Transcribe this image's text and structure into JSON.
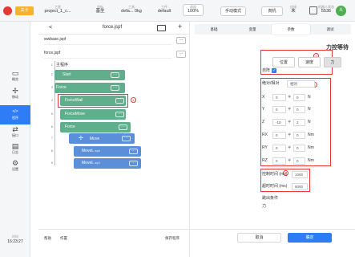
{
  "topbar": {
    "mode_label": "关卡",
    "project_small": "工程",
    "project": "project_1_c...",
    "coord_small": "坐标",
    "coord": "基坐",
    "tool_small": "工具",
    "tool": "defa... 0kg",
    "work_small": "工件",
    "work": "default",
    "speed_small": "速度",
    "speed": "100%",
    "manual_btn": "手动模式",
    "real_btn": "真机",
    "status_small": "连接",
    "status": "未",
    "user_small": "机器人状态",
    "user_val": "5536",
    "user_badge": "A"
  },
  "sidebar": {
    "items": [
      {
        "icon": "▭",
        "label": "概览"
      },
      {
        "icon": "✢",
        "label": "移动"
      },
      {
        "icon": "</>",
        "label": "程序"
      },
      {
        "icon": "⇄",
        "label": "接口"
      },
      {
        "icon": "▤",
        "label": "日志"
      },
      {
        "icon": "⚙",
        "label": "设置"
      }
    ],
    "time_label": "时间",
    "time": "16:23:27"
  },
  "editor": {
    "back": "<",
    "filename": "force.jspf",
    "files": [
      "wwbase.jspf",
      "force.jspf"
    ],
    "main": "主程序",
    "start": "Start",
    "force": "Force",
    "forcewall": "ForceWall",
    "forcemove": "ForceMove",
    "force2": "Force",
    "move": "Move",
    "movel1": "MoveL",
    "movel1_sub": "wp6",
    "movel2": "MoveL",
    "movel2_sub": "wp3",
    "dots": "···",
    "plus": "+",
    "lines": [
      "1",
      "2",
      "3",
      "4",
      "5",
      "6",
      "7",
      "8",
      "9"
    ],
    "help_btn": "帮助",
    "work_btn": "作置",
    "save_btn": "保存程序"
  },
  "panel": {
    "tabs": [
      "基础",
      "变量",
      "参数",
      "调试"
    ],
    "title": "力控等待",
    "btn_pos": "位置",
    "btn_speed": "速度",
    "btn_force": "力",
    "ref_label": "自阵",
    "coord_label": "绝对/相对",
    "coord_value": "相对",
    "rows": [
      {
        "name": "X",
        "a": "0",
        "b": "0",
        "unit": "N"
      },
      {
        "name": "Y",
        "a": "0",
        "b": "0",
        "unit": "N"
      },
      {
        "name": "Z",
        "a": "-10",
        "b": "2",
        "unit": "N"
      },
      {
        "name": "RX",
        "a": "0",
        "b": "0",
        "unit": "Nm"
      },
      {
        "name": "RY",
        "a": "0",
        "b": "0",
        "unit": "Nm"
      },
      {
        "name": "RZ",
        "a": "0",
        "b": "0",
        "unit": "Nm"
      }
    ],
    "pm": "∓",
    "hold_label": "控制时间 (ms)",
    "hold_value": "1000",
    "timeout_label": "超时时间 (ms)",
    "timeout_value": "5000",
    "cond_label": "跳出条件",
    "cond_value": "力",
    "cancel_btn": "取消",
    "ok_btn": "确定"
  },
  "callouts": [
    "5",
    "4",
    "6",
    "7"
  ]
}
